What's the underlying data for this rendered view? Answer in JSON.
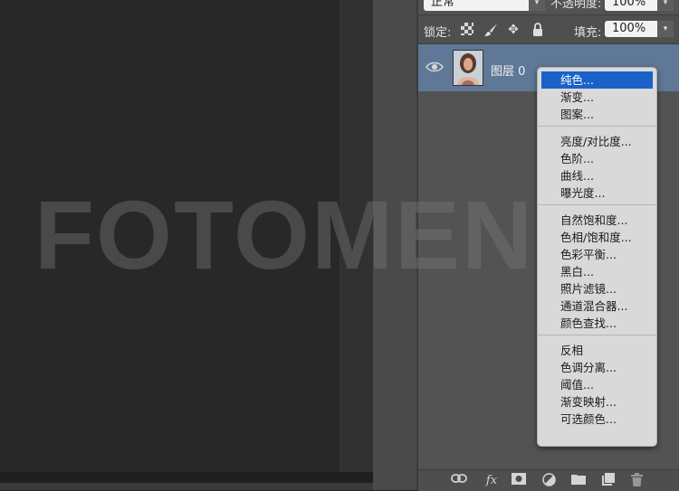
{
  "watermark": "FOTOMEN",
  "panel": {
    "blend_mode": "正常",
    "opacity_label": "不透明度:",
    "opacity_value": "100%",
    "lock_label": "锁定:",
    "fill_label": "填充:",
    "fill_value": "100%",
    "lock_icons": [
      "lock-transparent-icon",
      "brush-icon",
      "move-icon",
      "lock-icon"
    ]
  },
  "layer": {
    "name": "图层 0",
    "icons": [
      "eye-icon",
      "layer-thumbnail"
    ]
  },
  "menu": {
    "groups": [
      [
        "纯色...",
        "渐变...",
        "图案..."
      ],
      [
        "亮度/对比度...",
        "色阶...",
        "曲线...",
        "曝光度..."
      ],
      [
        "自然饱和度...",
        "色相/饱和度...",
        "色彩平衡...",
        "黑白...",
        "照片滤镜...",
        "通道混合器...",
        "颜色查找..."
      ],
      [
        "反相",
        "色调分离...",
        "阈值...",
        "渐变映射...",
        "可选颜色..."
      ]
    ],
    "selected": "纯色..."
  },
  "bottom_toolbar": {
    "fx_label": "fx",
    "icons": [
      "link-icon",
      "fx-icon",
      "mask-icon",
      "adjustment-icon",
      "folder-icon",
      "new-layer-icon",
      "trash-icon"
    ]
  },
  "colors": {
    "selection": "#1a61c9",
    "layer_highlight": "#5f7897",
    "panel_bg": "#535353"
  }
}
